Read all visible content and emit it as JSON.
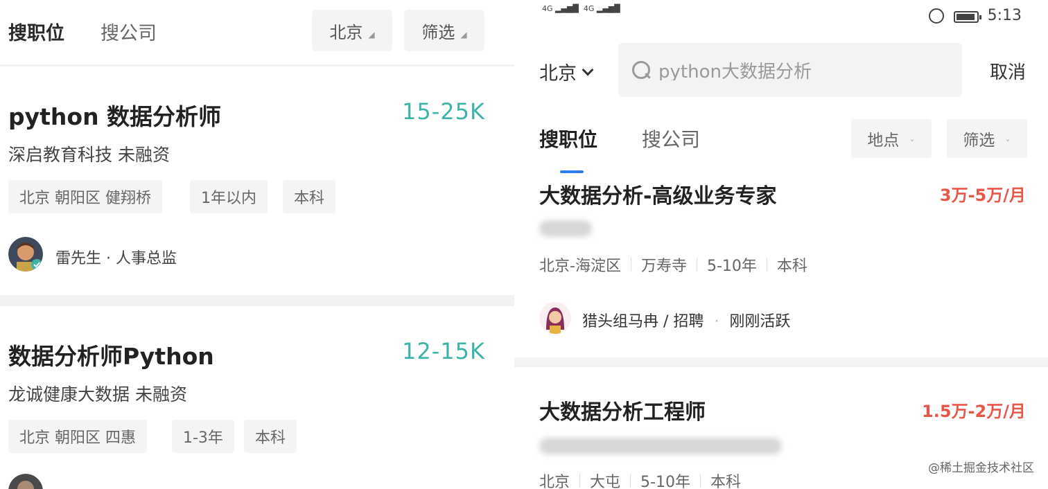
{
  "left": {
    "tabs": {
      "main": "搜职位",
      "sub": "搜公司"
    },
    "filters": {
      "city": "北京",
      "filter": "筛选"
    },
    "jobs": [
      {
        "title": "python 数据分析师",
        "salary": "15-25K",
        "company": "深启教育科技  未融资",
        "tags": [
          "北京 朝阳区 健翔桥",
          "1年以内",
          "本科"
        ],
        "recruiter": "雷先生 · 人事总监"
      },
      {
        "title": "数据分析师Python",
        "salary": "12-15K",
        "company": "龙诚健康大数据  未融资",
        "tags": [
          "北京 朝阳区 四惠",
          "1-3年",
          "本科"
        ]
      }
    ]
  },
  "right": {
    "status": {
      "time": "5:13",
      "signal": "4G"
    },
    "search": {
      "city": "北京",
      "query": "python大数据分析",
      "cancel": "取消"
    },
    "tabs": {
      "main": "搜职位",
      "sub": "搜公司"
    },
    "filters": {
      "location": "地点",
      "filter": "筛选"
    },
    "jobs": [
      {
        "title": "大数据分析-高级业务专家",
        "salary": "3万-5万/月",
        "meta": [
          "北京-海淀区",
          "万寿寺",
          "5-10年",
          "本科"
        ],
        "hunter": "猎头组马冉 / 招聘",
        "activity": "刚刚活跃"
      },
      {
        "title": "大数据分析工程师",
        "salary": "1.5万-2万/月",
        "meta": [
          "北京",
          "大屯",
          "5-10年",
          "本科"
        ]
      }
    ]
  },
  "watermark": "@稀土掘金技术社区",
  "colors": {
    "salary_left": "#3cb3a6",
    "salary_right": "#e8564a",
    "tab_indicator": "#2f7be8"
  }
}
